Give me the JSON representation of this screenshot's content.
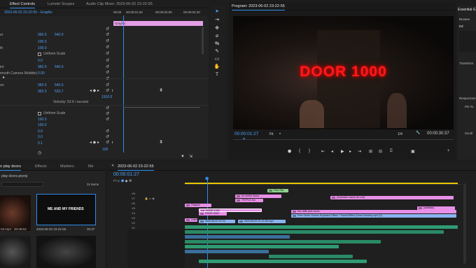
{
  "effect_controls": {
    "tabs": [
      "Effect Controls",
      "Lumetri Scopes",
      "Audio Clip Mixer: 2023-06-02 23-22-55"
    ],
    "sequence_label": "2023-06-02 23-22-55 - Graphic",
    "ruler": {
      "start": "00:00",
      "t1": "00:00:01:30",
      "t2": "00:00:02:00",
      "t3": "00:00:02:30"
    },
    "clip_name": "Graphic",
    "rows": [
      {
        "label": "er",
        "v1": "960.0",
        "v2": "540.0"
      },
      {
        "label": "",
        "v1": "100.0"
      },
      {
        "label": "th",
        "v1": "100.0"
      },
      {
        "label": "",
        "check": "Uniform Scale"
      },
      {
        "label": "",
        "v1": "0.0"
      },
      {
        "label": "int",
        "v1": "960.0",
        "v2": "540.0"
      },
      {
        "label": "",
        "v1": "0.00"
      },
      {
        "label": "mooth Camera Wobble)"
      },
      {
        "label": "on",
        "v1": "960.0",
        "v2": "540.0"
      },
      {
        "label": "",
        "v1": "963.3",
        "v2": "533.7"
      },
      {
        "label": "",
        "v1": "1910.0"
      },
      {
        "label": "",
        "velocity": "Velocity: 53.6 / second"
      },
      {
        "label": "",
        "check": "Uniform Scale"
      },
      {
        "label": "",
        "v1": "100.0"
      },
      {
        "label": "",
        "v1": "100.0"
      },
      {
        "label": "",
        "v1": "0.0"
      },
      {
        "label": "",
        "v1": "0.0"
      },
      {
        "label": "",
        "v1": "0.1"
      }
    ],
    "bottom_value": "100"
  },
  "program_monitor": {
    "title": "Program: 2023-06-02 23-22-55",
    "video_text": "DOOR 1000",
    "timecode": "00:00:01:27",
    "fit": "Fit",
    "resolution": "1/4",
    "duration": "00:00:30:37"
  },
  "essential_graphics": {
    "title": "Essential G",
    "tabs": [
      "Browse",
      "Ed"
    ],
    "sections": [
      "Transform",
      "Responsive",
      "Pin To",
      "Scroll"
    ]
  },
  "project_panel": {
    "tabs": [
      "o play doors",
      "Effects",
      "Markers",
      "Me"
    ],
    "project_file": "play doors.prproj",
    "item_count": "31 items",
    "thumbs": [
      {
        "name": "03.mp4",
        "duration": "20:48:53"
      },
      {
        "name": "2023-06-02 23-22-55",
        "duration": "30:37",
        "text": "ME AND MY FRIENDS"
      }
    ]
  },
  "timeline": {
    "title": "2023-06-02 23-22-55",
    "timecode": "00:00:01:27",
    "video_tracks": [
      "V8",
      "V7",
      "V6",
      "V5",
      "V4",
      "V3",
      "V2",
      "V1"
    ],
    "audio_tracks": [
      "A1",
      "A2",
      "A3",
      "A4",
      "A5",
      "A6",
      "A7",
      "Mix"
    ],
    "mix_value": "0.0",
    "clips": [
      {
        "name": "Free Gla",
        "color": "#8fd18f"
      },
      {
        "name": "an ohhhh doors",
        "color": "#e88fe8"
      },
      {
        "name": "TRYPLE bro",
        "color": "#e88fe8"
      },
      {
        "name": "(explosion cause its cool)",
        "color": "#e88fe8"
      },
      {
        "name": "DOOR 1000",
        "color": "#e88fe8"
      },
      {
        "name": "Graphic",
        "color": "#e88fe8"
      },
      {
        "name": "DOOR 5000",
        "color": "#e88fe8"
      },
      {
        "name": "five drills plus doors",
        "color": "#e88fe8"
      },
      {
        "name": "(sarfafas)",
        "color": "#e88fe8"
      },
      {
        "name": "2023-06-02 23-22-55.mp4",
        "color": "#8ab4f0"
      },
      {
        "name": "Free Green Screen Explosion Effect + Sound Effect (Good Version).mp4 [V]",
        "color": "#8ab4f0"
      },
      {
        "name": "2023-06-02 23-22-",
        "color": "#8ab4f0"
      },
      {
        "name": "Uniiel",
        "color": "#e88fe8"
      }
    ]
  }
}
